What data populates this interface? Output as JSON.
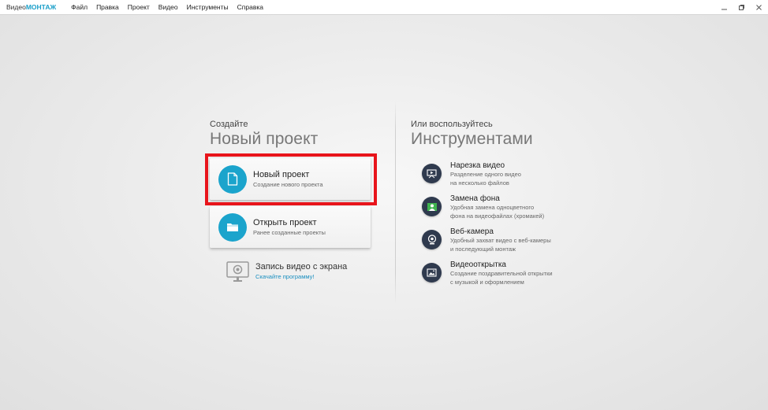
{
  "app": {
    "logo_plain": "Видео",
    "logo_accent": "МОНТАЖ",
    "accent_color": "#1a9fc9"
  },
  "menu": [
    {
      "label": "Файл"
    },
    {
      "label": "Правка"
    },
    {
      "label": "Проект"
    },
    {
      "label": "Видео"
    },
    {
      "label": "Инструменты"
    },
    {
      "label": "Справка"
    }
  ],
  "left": {
    "kicker": "Создайте",
    "title": "Новый проект",
    "new_project": {
      "title": "Новый проект",
      "subtitle": "Создание нового проекта",
      "icon": "document-icon"
    },
    "open_project": {
      "title": "Открыть проект",
      "subtitle": "Ранее созданные проекты",
      "icon": "folder-icon"
    },
    "record": {
      "title": "Запись видео с экрана",
      "link": "Скачайте программу!",
      "icon": "monitor-webcam-icon"
    }
  },
  "right": {
    "kicker": "Или воспользуйтесь",
    "title": "Инструментами",
    "tools": [
      {
        "title": "Нарезка видео",
        "desc1": "Разделение одного видео",
        "desc2": "на несколько файлов",
        "icon": "cut-video-icon"
      },
      {
        "title": "Замена фона",
        "desc1": "Удобная замена одноцветного",
        "desc2": "фона на видеофайлах (хромакей)",
        "icon": "chroma-key-icon"
      },
      {
        "title": "Веб-камера",
        "desc1": "Удобный захват видео с веб-камеры",
        "desc2": "и последующий монтаж",
        "icon": "webcam-icon"
      },
      {
        "title": "Видеооткрытка",
        "desc1": "Создание поздравительной открытки",
        "desc2": "с музыкой и оформлением",
        "icon": "postcard-icon"
      }
    ]
  },
  "colors": {
    "card_circle": "#1ba4cc",
    "tool_circle": "#2f3a4e",
    "highlight_border": "#e8141b",
    "link": "#1a8fc0"
  }
}
